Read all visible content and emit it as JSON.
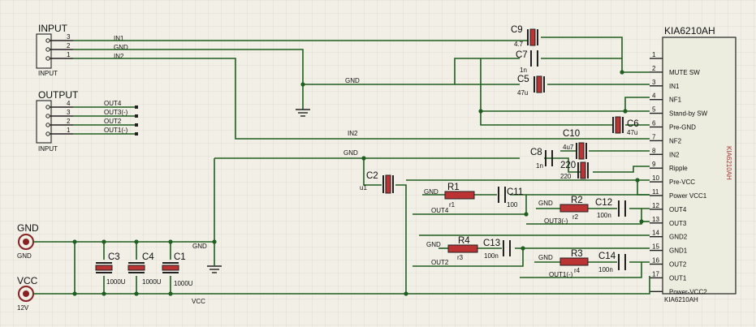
{
  "ic": {
    "title": "KIA6210AH",
    "footer": "KIA6210AH",
    "vertical_label": "KIA6210AH",
    "pins": [
      {
        "num": "1",
        "name": ""
      },
      {
        "num": "2",
        "name": "MUTE SW"
      },
      {
        "num": "3",
        "name": "IN1"
      },
      {
        "num": "4",
        "name": "NF1"
      },
      {
        "num": "5",
        "name": "Stand-by SW"
      },
      {
        "num": "6",
        "name": "Pre-GND"
      },
      {
        "num": "7",
        "name": "NF2"
      },
      {
        "num": "8",
        "name": "IN2"
      },
      {
        "num": "9",
        "name": "Ripple"
      },
      {
        "num": "10",
        "name": "Pre-VCC"
      },
      {
        "num": "11",
        "name": "Power VCC1"
      },
      {
        "num": "12",
        "name": "OUT4"
      },
      {
        "num": "13",
        "name": "OUT3"
      },
      {
        "num": "14",
        "name": "GND2"
      },
      {
        "num": "15",
        "name": "GND1"
      },
      {
        "num": "16",
        "name": "OUT2"
      },
      {
        "num": "17",
        "name": "OUT1"
      },
      {
        "num": "",
        "name": "Power-VCC2"
      }
    ]
  },
  "input_conn": {
    "title": "INPUT",
    "footer": "INPUT",
    "pins": [
      "3",
      "2",
      "1"
    ],
    "nets": [
      "IN1",
      "GND",
      "IN2"
    ]
  },
  "output_conn": {
    "title": "OUTPUT",
    "footer": "INPUT",
    "pins": [
      "4",
      "3",
      "2",
      "1"
    ],
    "nets": [
      "OUT4",
      "OUT3(-)",
      "OUT2",
      "OUT1(-)"
    ]
  },
  "terminals": [
    {
      "ref": "GND",
      "sub": "GND"
    },
    {
      "ref": "VCC",
      "sub": "12V"
    }
  ],
  "nets": {
    "gnd": "GND",
    "gnd2": "GND",
    "gnd3": "GND",
    "in2": "IN2",
    "vcc": "VCC",
    "out4": "OUT4",
    "out3": "OUT3(-)",
    "out2": "OUT2",
    "out1": "OUT1(-)",
    "g1": "GND",
    "g2": "GND",
    "g3": "GND",
    "g4": "GND"
  },
  "caps": {
    "C9": {
      "ref": "C9",
      "val": "4.7"
    },
    "C7": {
      "ref": "C7",
      "val": "1n"
    },
    "C5": {
      "ref": "C5",
      "val": "47u"
    },
    "C6": {
      "ref": "C6",
      "val": "47u"
    },
    "C10": {
      "ref": "C10",
      "val": "4u7"
    },
    "C8": {
      "ref": "C8",
      "val": "1n"
    },
    "C220": {
      "ref": "220",
      "val": "220"
    },
    "C2": {
      "ref": "C2",
      "val": "u1"
    },
    "C11": {
      "ref": "C11",
      "val": "100"
    },
    "C12": {
      "ref": "C12",
      "val": "100n"
    },
    "C13": {
      "ref": "C13",
      "val": "100n"
    },
    "C14": {
      "ref": "C14",
      "val": "100n"
    },
    "C3": {
      "ref": "C3",
      "val": "1000U"
    },
    "C4": {
      "ref": "C4",
      "val": "1000U"
    },
    "C1": {
      "ref": "C1",
      "val": "1000U"
    }
  },
  "resistors": {
    "R1": {
      "ref": "R1",
      "val": "r1"
    },
    "R2": {
      "ref": "R2",
      "val": "r2"
    },
    "R4": {
      "ref": "R4",
      "val": "r3"
    },
    "R3": {
      "ref": "R3",
      "val": "r4"
    }
  }
}
